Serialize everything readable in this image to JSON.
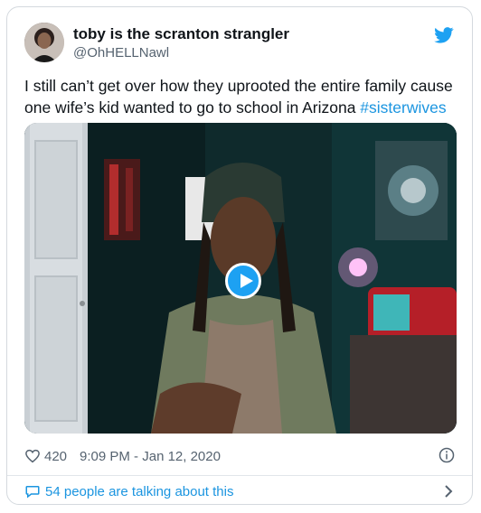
{
  "tweet": {
    "display_name": "toby is the scranton strangler",
    "handle": "@OhHELLNawl",
    "text_before": "I still can’t get over how they uprooted the entire family cause one wife’s kid wanted to go to school in Arizona ",
    "hashtag": "#sisterwives",
    "like_count": "420",
    "timestamp": "9:09 PM - Jan 12, 2020",
    "talking_text": "54 people are talking about this"
  },
  "colors": {
    "accent": "#1b95e0",
    "text": "#0f1419",
    "secondary": "#566370",
    "border": "#d4d9de"
  }
}
